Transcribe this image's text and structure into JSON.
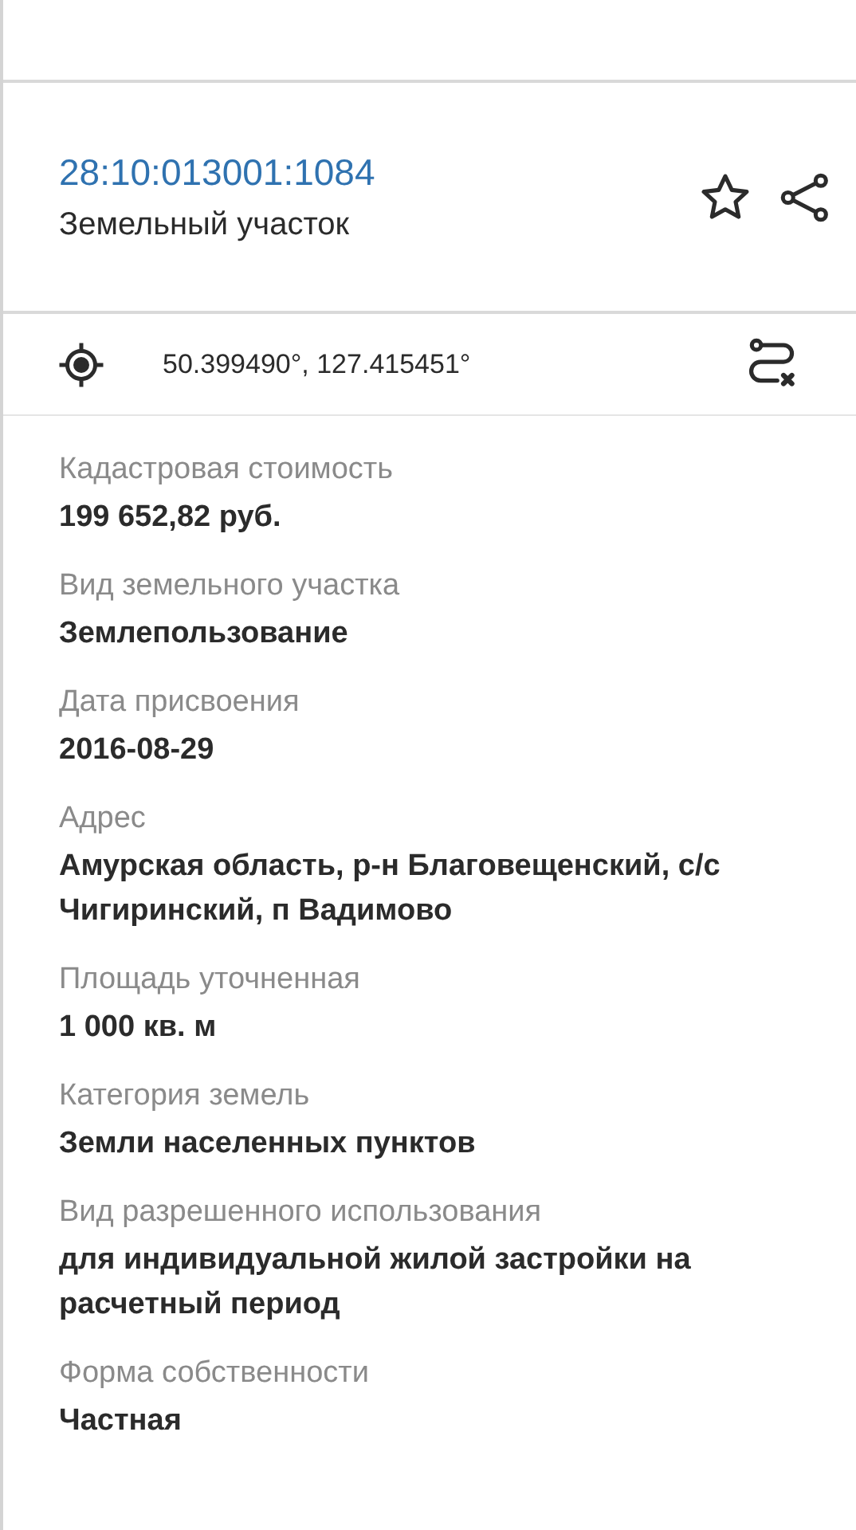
{
  "header": {
    "cadastral_number": "28:10:013001:1084",
    "object_type": "Земельный участок",
    "favorite": false
  },
  "coordinates": "50.399490°, 127.415451°",
  "fields": [
    {
      "label": "Кадастровая стоимость",
      "value": "199 652,82 руб."
    },
    {
      "label": "Вид земельного участка",
      "value": "Землепользование"
    },
    {
      "label": "Дата присвоения",
      "value": "2016-08-29"
    },
    {
      "label": "Адрес",
      "value": "Амурская область, р-н Благовещенский, с/с Чигиринский, п Вадимово"
    },
    {
      "label": "Площадь уточненная",
      "value": "1 000 кв. м"
    },
    {
      "label": "Категория земель",
      "value": "Земли населенных пунктов"
    },
    {
      "label": "Вид разрешенного использования",
      "value": "для индивидуальной жилой застройки на расчетный период"
    },
    {
      "label": "Форма собственности",
      "value": "Частная"
    }
  ]
}
